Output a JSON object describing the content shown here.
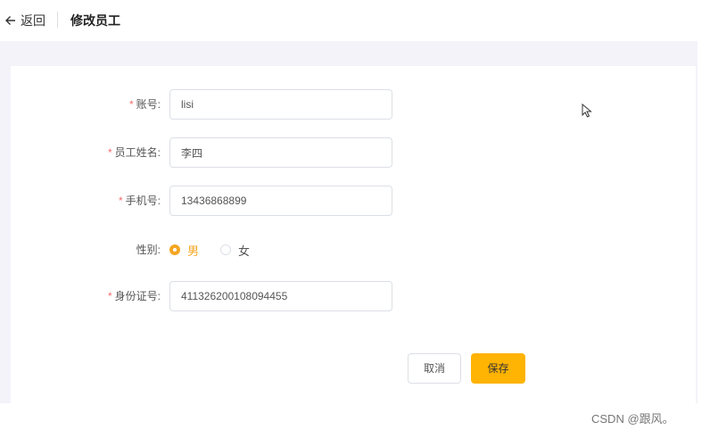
{
  "header": {
    "back_label": "返回",
    "title": "修改员工"
  },
  "form": {
    "fields": [
      {
        "label": "账号:",
        "value": "lisi",
        "required": "*"
      },
      {
        "label": "员工姓名:",
        "value": "李四",
        "required": "*"
      },
      {
        "label": "手机号:",
        "value": "13436868899",
        "required": "*"
      },
      {
        "label": "身份证号:",
        "value": "411326200108094455",
        "required": "*"
      }
    ],
    "gender": {
      "label": "性别:",
      "options": [
        "男",
        "女"
      ],
      "selected": "男"
    }
  },
  "buttons": {
    "cancel": "取消",
    "save": "保存"
  },
  "watermark": "CSDN @跟风。",
  "colors": {
    "accent": "#ffb302",
    "radio_checked": "#f5a623",
    "required": "#f56c6c"
  }
}
